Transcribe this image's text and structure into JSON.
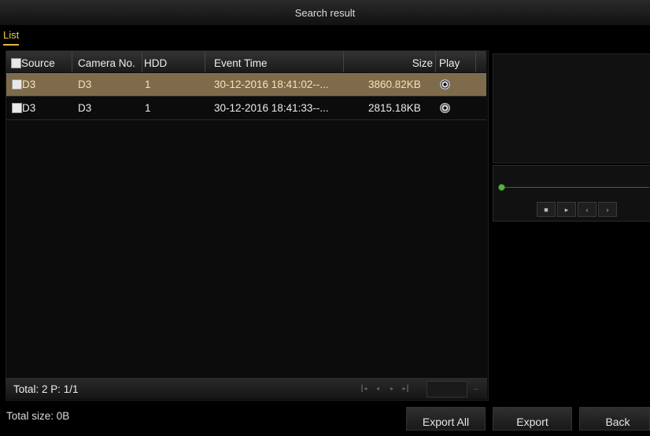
{
  "window": {
    "title": "Search result"
  },
  "tabs": [
    {
      "label": "List",
      "active": true
    }
  ],
  "table": {
    "headers": [
      "Source",
      "Camera No.",
      "HDD",
      "Event Time",
      "Size",
      "Play"
    ],
    "rows": [
      {
        "source": "D3",
        "camera": "D3",
        "hdd": "1",
        "time": "30-12-2016 18:41:02--...",
        "size": "3860.82KB",
        "selected": true
      },
      {
        "source": "D3",
        "camera": "D3",
        "hdd": "1",
        "time": "30-12-2016 18:41:33--...",
        "size": "2815.18KB",
        "selected": false
      }
    ]
  },
  "footer": {
    "total": "Total: 2  P: 1/1"
  },
  "bottom": {
    "total_size": "Total size: 0B"
  },
  "buttons": {
    "export_all": "Export All",
    "export": "Export",
    "back": "Back"
  },
  "colors": {
    "accent": "#e3b937",
    "selected_row": "#7d6b4b",
    "seek_knob": "#5fb041"
  }
}
